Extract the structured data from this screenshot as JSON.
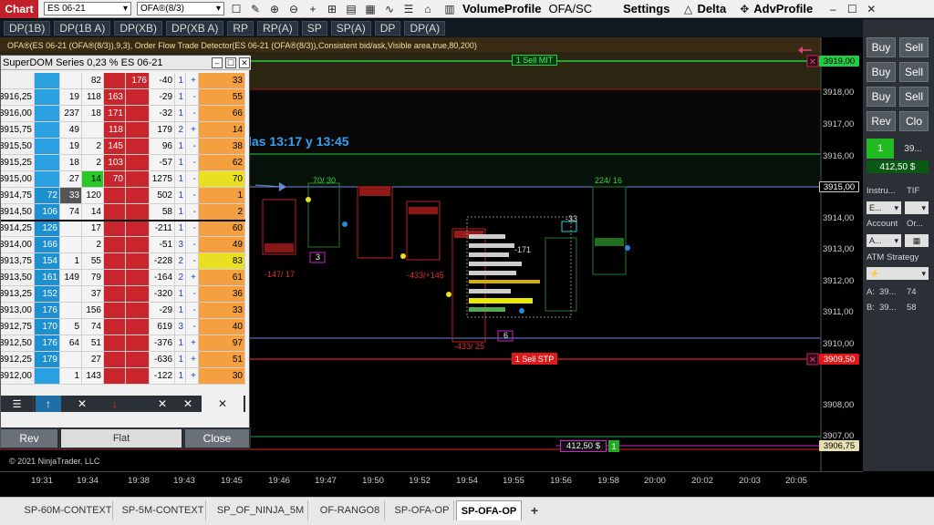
{
  "toolbar": {
    "chart_label": "Chart",
    "instrument": "ES 06-21",
    "indicator": "OFA®(8/3)",
    "volume_profile": "VolumeProfile",
    "ofa_sc": "OFA/SC",
    "settings": "Settings",
    "delta": "Delta",
    "adv_profile": "AdvProfile"
  },
  "dp_buttons": [
    "DP(1B)",
    "DP(1B A)",
    "DP(XB)",
    "DP(XB A)",
    "RP",
    "RP(A)",
    "SP",
    "SP(A)",
    "DP",
    "DP(A)"
  ],
  "chart": {
    "indicator_line": "OFA®(ES 06-21 (OFA®(8/3)),9,3), Order Flow Trade Detector(ES 06-21 (OFA®(8/3)),Consistent bid/ask,Visible area,true,80,200)",
    "session_text": "las 13:17 y  13:45",
    "copyright": "© 2021 NinjaTrader, LLC",
    "sell_mit": "1  Sell MIT",
    "sell_stp": "1  Sell STP",
    "pnl_tag": "412,50 $",
    "pnl_qty": "1",
    "ask_vol_1": "70/ 30",
    "ask_vol_2": "224/ 16",
    "delta_1": "-147/ 17",
    "delta_2": "-433/ 25",
    "delta_3": "-433/+145",
    "vol_labels": [
      "-171",
      "-33"
    ],
    "box_values": [
      "3",
      "6"
    ]
  },
  "price_axis": {
    "labels": [
      "3918,00",
      "3917,00",
      "3916,00",
      "3915,00",
      "3914,00",
      "3913,00",
      "3912,00",
      "3911,00",
      "3910,00",
      "3909,50",
      "3909,00",
      "3908,00",
      "3907,00",
      "3906,75"
    ],
    "mit_price": "3919,00",
    "stp_price": "3909,50",
    "last_price": "3915,00",
    "current_price": "3906,75"
  },
  "x_axis": {
    "labels": [
      "19:31",
      "19:34",
      "19:38",
      "19:43",
      "19:45",
      "19:46",
      "19:47",
      "19:50",
      "19:52",
      "19:54",
      "19:55",
      "19:56",
      "19:58",
      "20:00",
      "20:02",
      "20:03",
      "20:05"
    ]
  },
  "superdom": {
    "title": "SuperDOM Series 0,23 % ES 06-21",
    "rows": [
      {
        "price": "",
        "bid": "",
        "c3": "",
        "c4": "82",
        "c5": "",
        "ask": "176",
        "c7": "-40",
        "c8": "1",
        "c9": "+",
        "vol": "33"
      },
      {
        "price": "3916,25",
        "bid": "",
        "c3": "19",
        "c4": "118",
        "c5": "163",
        "ask": "",
        "c7": "-29",
        "c8": "1",
        "c9": "-",
        "vol": "55"
      },
      {
        "price": "3916,00",
        "bid": "",
        "c3": "237",
        "c4": "18",
        "c5": "171",
        "ask": "",
        "c7": "-32",
        "c8": "1",
        "c9": "-",
        "vol": "66"
      },
      {
        "price": "3915,75",
        "bid": "",
        "c3": "49",
        "c4": "",
        "c5": "118",
        "ask": "",
        "c7": "179",
        "c8": "2",
        "c9": "+",
        "vol": "14"
      },
      {
        "price": "3915,50",
        "bid": "",
        "c3": "19",
        "c4": "2",
        "c5": "145",
        "ask": "",
        "c7": "96",
        "c8": "1",
        "c9": "-",
        "vol": "38"
      },
      {
        "price": "3915,25",
        "bid": "",
        "c3": "18",
        "c4": "2",
        "c5": "103",
        "ask": "",
        "c7": "-57",
        "c8": "1",
        "c9": "-",
        "vol": "62"
      },
      {
        "price": "3915,00",
        "bid": "",
        "c3": "27",
        "c4": "14",
        "c5": "70",
        "ask": "",
        "c7": "1275",
        "c8": "1",
        "c9": "-",
        "vol": "70"
      },
      {
        "price": "3914,75",
        "bid": "72",
        "c3": "33",
        "c4": "120",
        "c5": "",
        "ask": "",
        "c7": "502",
        "c8": "1",
        "c9": "-",
        "vol": "1"
      },
      {
        "price": "3914,50",
        "bid": "106",
        "c3": "74",
        "c4": "14",
        "c5": "",
        "ask": "",
        "c7": "58",
        "c8": "1",
        "c9": "-",
        "vol": "2"
      },
      {
        "price": "3914,25",
        "bid": "126",
        "c3": "",
        "c4": "17",
        "c5": "",
        "ask": "",
        "c7": "-211",
        "c8": "1",
        "c9": "-",
        "vol": "60"
      },
      {
        "price": "3914,00",
        "bid": "166",
        "c3": "",
        "c4": "2",
        "c5": "",
        "ask": "",
        "c7": "-51",
        "c8": "3",
        "c9": "-",
        "vol": "49"
      },
      {
        "price": "3913,75",
        "bid": "154",
        "c3": "1",
        "c4": "55",
        "c5": "",
        "ask": "",
        "c7": "-228",
        "c8": "2",
        "c9": "-",
        "vol": "83"
      },
      {
        "price": "3913,50",
        "bid": "161",
        "c3": "149",
        "c4": "79",
        "c5": "",
        "ask": "",
        "c7": "-164",
        "c8": "2",
        "c9": "+",
        "vol": "61"
      },
      {
        "price": "3913,25",
        "bid": "152",
        "c3": "",
        "c4": "37",
        "c5": "",
        "ask": "",
        "c7": "-320",
        "c8": "1",
        "c9": "-",
        "vol": "36"
      },
      {
        "price": "3913,00",
        "bid": "176",
        "c3": "",
        "c4": "156",
        "c5": "",
        "ask": "",
        "c7": "-29",
        "c8": "1",
        "c9": "-",
        "vol": "33"
      },
      {
        "price": "3912,75",
        "bid": "170",
        "c3": "5",
        "c4": "74",
        "c5": "",
        "ask": "",
        "c7": "619",
        "c8": "3",
        "c9": "-",
        "vol": "40"
      },
      {
        "price": "3912,50",
        "bid": "176",
        "c3": "64",
        "c4": "51",
        "c5": "",
        "ask": "",
        "c7": "-376",
        "c8": "1",
        "c9": "+",
        "vol": "97"
      },
      {
        "price": "3912,25",
        "bid": "179",
        "c3": "",
        "c4": "27",
        "c5": "",
        "ask": "",
        "c7": "-636",
        "c8": "1",
        "c9": "+",
        "vol": "51"
      },
      {
        "price": "3912,00",
        "bid": "",
        "c3": "1",
        "c4": "143",
        "c5": "",
        "ask": "",
        "c7": "-122",
        "c8": "1",
        "c9": "+",
        "vol": "30"
      }
    ],
    "rev_label": "Rev",
    "flat_label": "Flat",
    "close_label": "Close"
  },
  "right_panel": {
    "buy1": "Buy",
    "sell1": "Sell",
    "buy2": "Buy",
    "sell2": "Sell",
    "buy3": "Buy",
    "sell3": "Sell",
    "rev": "Rev",
    "clo": "Clo",
    "pos_qty": "1",
    "pos_price": "39...",
    "pnl": "412,50 $",
    "instrument_label": "Instru...",
    "tif_label": "TIF",
    "instrument_value": "E...",
    "account_label": "Account",
    "order_label": "Or...",
    "account_value": "A...",
    "atm_label": "ATM Strategy",
    "a_label": "A:",
    "a_price": "39...",
    "a_qty": "74",
    "b_label": "B:",
    "b_price": "39...",
    "b_qty": "58"
  },
  "tabs": [
    "SP-60M-CONTEXT",
    "SP-5M-CONTEXT",
    "SP_OF_NINJA_5M",
    "OF-RANGO8",
    "SP-OFA-OP",
    "SP-OFA-OP"
  ],
  "active_tab": 5,
  "colors": {
    "bid_blue": "#1e8fd0",
    "ask_red": "#c8262c",
    "mit_green": "#22cc44",
    "stp_red": "#e02020",
    "bg": "#000000"
  }
}
